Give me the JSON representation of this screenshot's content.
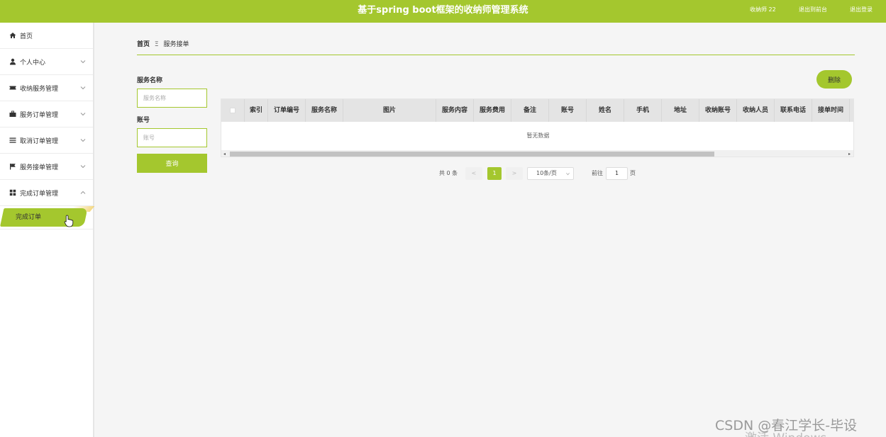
{
  "header": {
    "title": "基于spring boot框架的收纳师管理系统",
    "user": "收纳师 22",
    "back_link": "退出到前台",
    "logout_link": "退出登录"
  },
  "sidebar": {
    "items": [
      {
        "label": "首页",
        "icon": "home-icon"
      },
      {
        "label": "个人中心",
        "icon": "user-icon"
      },
      {
        "label": "收纳服务管理",
        "icon": "ticket-icon"
      },
      {
        "label": "服务订单管理",
        "icon": "briefcase-icon"
      },
      {
        "label": "取消订单管理",
        "icon": "list-icon"
      },
      {
        "label": "服务接单管理",
        "icon": "flag-icon"
      },
      {
        "label": "完成订单管理",
        "icon": "grid-icon"
      }
    ],
    "submenu_active": "完成订单"
  },
  "breadcrumb": {
    "home": "首页",
    "separator": "Ξ",
    "current": "服务接单"
  },
  "filters": {
    "service_name_label": "服务名称",
    "service_name_placeholder": "服务名称",
    "account_label": "账号",
    "account_placeholder": "账号",
    "query_button": "查询"
  },
  "actions": {
    "delete_button": "删除"
  },
  "table": {
    "columns": [
      "索引",
      "订单编号",
      "服务名称",
      "图片",
      "服务内容",
      "服务费用",
      "备注",
      "账号",
      "姓名",
      "手机",
      "地址",
      "收纳账号",
      "收纳人员",
      "联系电话",
      "接单时间"
    ],
    "empty_text": "暂无数据"
  },
  "pagination": {
    "total": "共 0 条",
    "prev": "<",
    "current_page": "1",
    "next": ">",
    "page_size": "10条/页",
    "goto_label": "前往",
    "goto_value": "1",
    "page_suffix": "页"
  },
  "watermark": {
    "csdn": "CSDN @春江学长-毕设",
    "activate": "激活 Windows"
  },
  "colors": {
    "accent": "#a4c72e",
    "background": "#f5f5f5"
  }
}
